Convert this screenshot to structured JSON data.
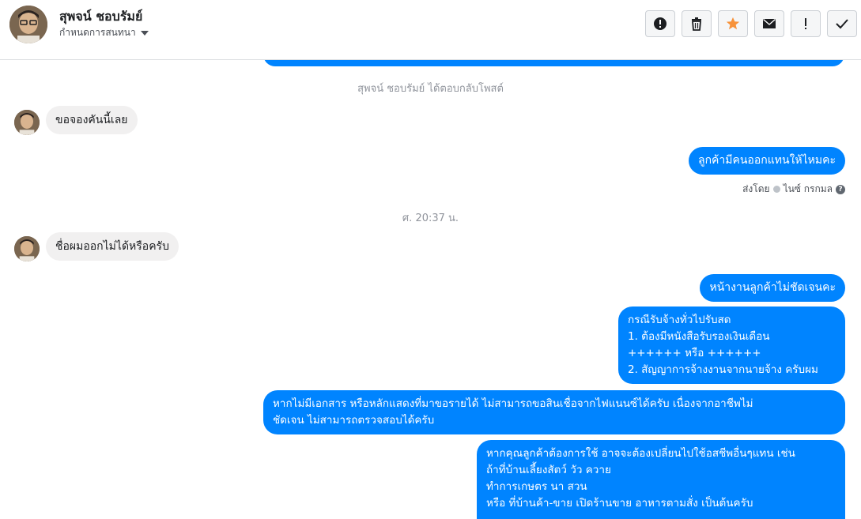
{
  "header": {
    "contact_name": "สุพจน์ ชอบรัมย์",
    "assign_label": "กำหนดการสนทนา",
    "actions": [
      "spam-icon",
      "trash-icon",
      "star-icon",
      "mail-icon",
      "important-icon",
      "check-icon"
    ]
  },
  "thread": {
    "reply_note": "สุพจน์ ชอบรัมย์ ได้ตอบกลับโพสต์",
    "msg_in_1": "ขอจองคันนี้เลย",
    "msg_out_1": "ลูกค้ามีคนออกแทนให้ไหมคะ",
    "sent_by_prefix": "ส่งโดย",
    "sent_by_name": "ไนซ์ กรกมล",
    "timestamp": "ศ. 20:37 น.",
    "msg_in_2": "ชื่อผมออกไม่ได้หรือครับ",
    "msg_out_2": "หน้างานลูกค้าไม่ชัดเจนคะ",
    "msg_out_3": "กรณีรับจ้างทั่วไปรับสด\n1. ต้องมีหนังสือรับรองเงินเดือน\n++++++ หรือ ++++++\n2. สัญญาการจ้างงานจากนายจ้าง ครับผม",
    "msg_out_4": "หากไม่มีเอกสาร หรือหลักแสดงที่มาขอรายได้ ไม่สามารถขอสินเชื่อจากไฟแนนซ์ได้ครับ เนื่องจากอาชีพไม่\nชัดเจน ไม่สามารถตรวจสอบได้ครับ",
    "msg_out_5": "หากคุณลูกค้าต้องการใช้ อาจจะต้องเปลี่ยนไปใช้อสชีพอื่นๆแทน เช่น\nถ้าที่บ้านเลี้ยงสัตว์ วัว ควาย\nทำการเกษตร นา สวน\nหรือ ที่บ้านค้า-ขาย เปิดร้านขาย อาหารตามสั่ง เป็นต้นครับ"
  },
  "colors": {
    "bubble_out": "#0084ff",
    "bubble_in": "#f1f0f0",
    "star": "#f7923a"
  }
}
